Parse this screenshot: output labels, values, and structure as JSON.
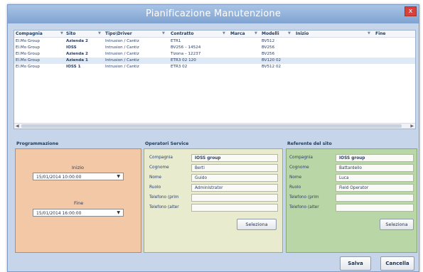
{
  "window": {
    "title": "Pianificazione Manutenzione",
    "close_glyph": "x"
  },
  "grid": {
    "columns": [
      "Compagnia",
      "Sito",
      "Tipo\\Driver",
      "Contratto",
      "Marca",
      "Modelli",
      "Inizio",
      "Fine"
    ],
    "rows": [
      [
        "El.Mo Group",
        "Azienda 2",
        "Intrusion / Cantiz",
        "ETR1",
        "",
        "BV512",
        "",
        ""
      ],
      [
        "El.Mo Group",
        "IOSS",
        "Intrusion / Cantiz",
        "BV256 – 14524",
        "",
        "BV256",
        "",
        ""
      ],
      [
        "El.Mo Group",
        "Azienda 2",
        "Intrusion / Cantiz",
        "Tizona – 12237",
        "",
        "BV256",
        "",
        ""
      ],
      [
        "El.Mo Group",
        "Azienda 1",
        "Intrusion / Cantiz",
        "ETR3 02 120",
        "",
        "BV120 02",
        "",
        ""
      ],
      [
        "El.Mo Group",
        "IOSS 1",
        "Intrusion / Cantiz",
        "ETR3 02",
        "",
        "BV512 02",
        "",
        ""
      ]
    ],
    "selected_row": 3
  },
  "programmazione": {
    "title": "Programmazione",
    "start_label": "Inizio",
    "start_value": "15/01/2014 10:00:00",
    "end_label": "Fine",
    "end_value": "15/01/2014 16:00:00"
  },
  "operatori": {
    "title": "Operatori Service",
    "fields": [
      {
        "label": "Compagnia",
        "value": "IOSS group"
      },
      {
        "label": "Cognome",
        "value": "Berti"
      },
      {
        "label": "Nome",
        "value": "Guido"
      },
      {
        "label": "Ruolo",
        "value": "Administrator"
      },
      {
        "label": "Telefono (prim",
        "value": ""
      },
      {
        "label": "Telefono (alter",
        "value": ""
      }
    ],
    "select_label": "Seleziona"
  },
  "referente": {
    "title": "Referente del sito",
    "fields": [
      {
        "label": "Compagnia",
        "value": "IOSS group"
      },
      {
        "label": "Cognome",
        "value": "Battardello"
      },
      {
        "label": "Nome",
        "value": "Luca"
      },
      {
        "label": "Ruolo",
        "value": "Field Operator"
      },
      {
        "label": "Telefono (prim",
        "value": ""
      },
      {
        "label": "Telefono (alter",
        "value": ""
      }
    ],
    "select_label": "Seleziona"
  },
  "footer": {
    "save_label": "Salva",
    "cancel_label": "Cancella"
  },
  "colors": {
    "titlebar": "#7fa3d2",
    "programmazione_bg": "#f2c8a6",
    "operatori_bg": "#e9ebcf",
    "referente_bg": "#b9d6a6",
    "close_button": "#d9413a"
  }
}
